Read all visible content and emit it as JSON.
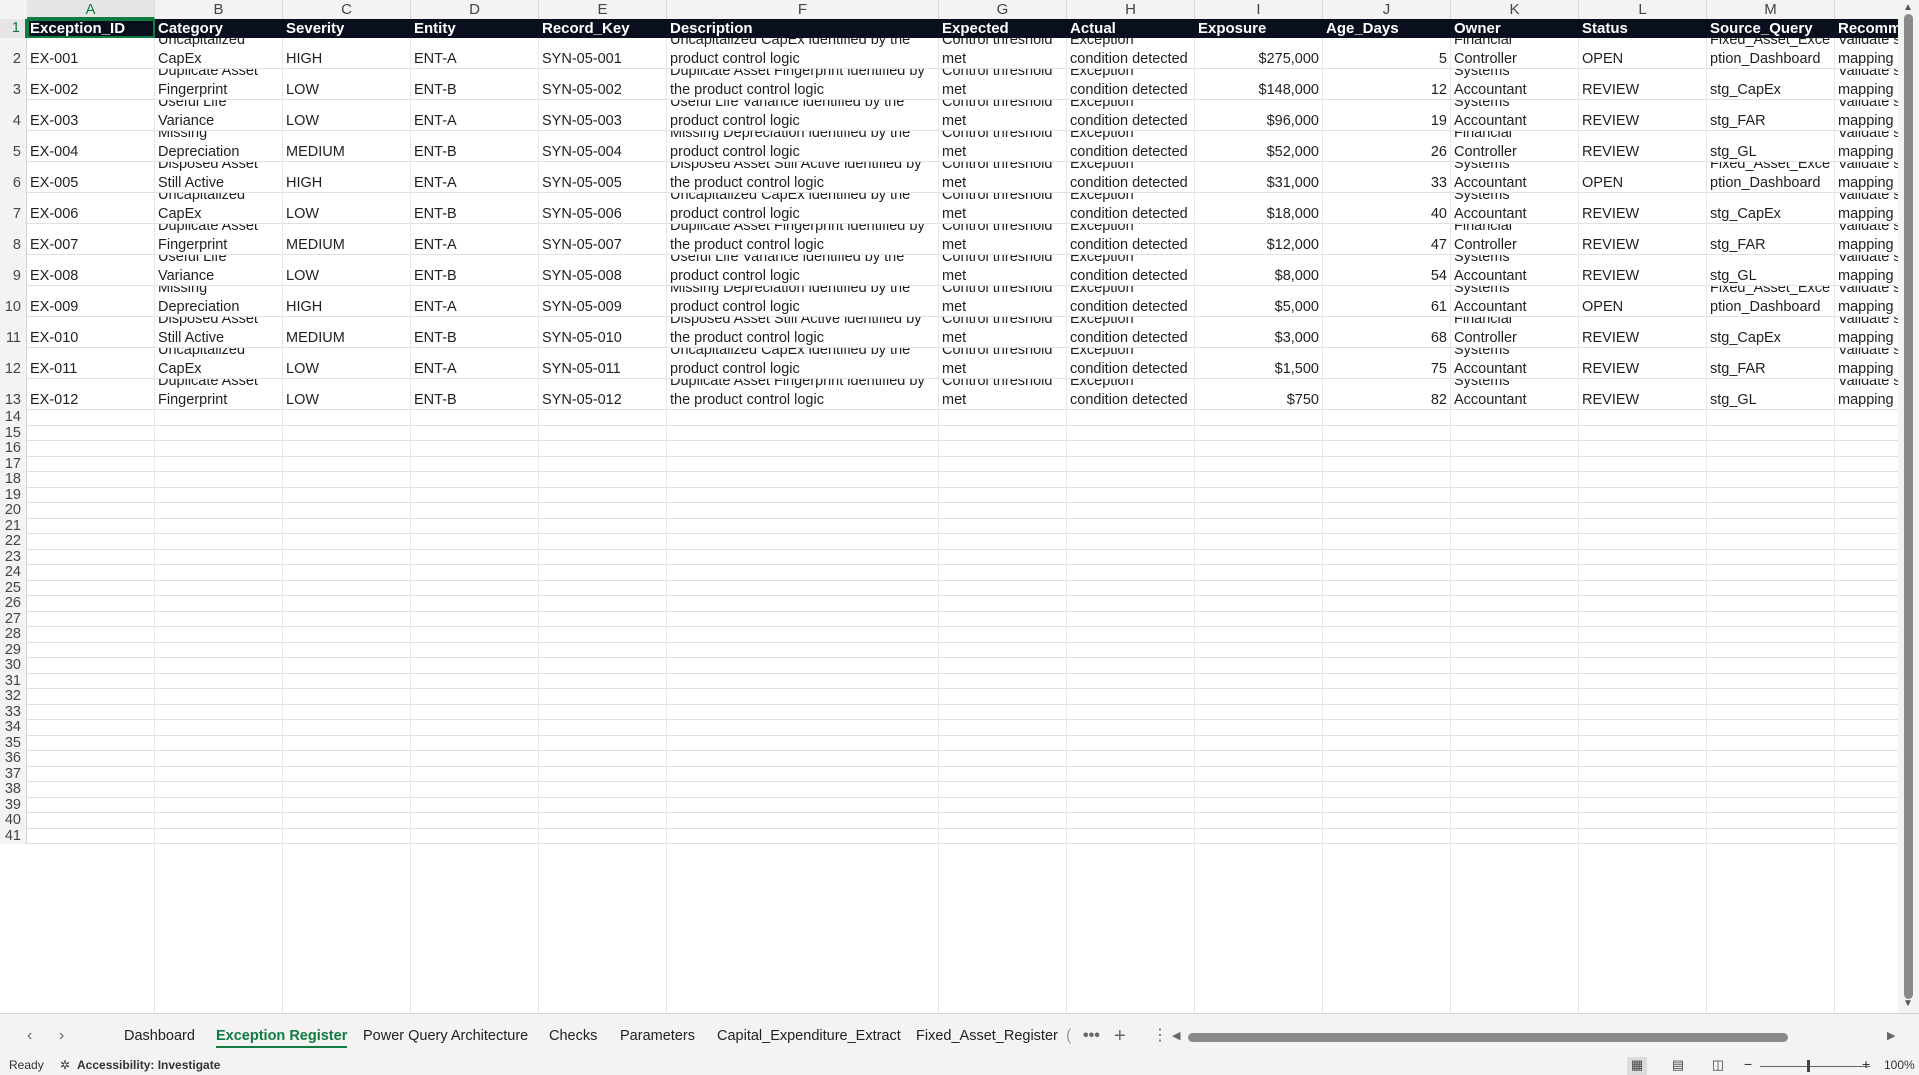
{
  "columns": [
    {
      "letter": "A",
      "header": "Exception_ID"
    },
    {
      "letter": "B",
      "header": "Category"
    },
    {
      "letter": "C",
      "header": "Severity"
    },
    {
      "letter": "D",
      "header": "Entity"
    },
    {
      "letter": "E",
      "header": "Record_Key"
    },
    {
      "letter": "F",
      "header": "Description"
    },
    {
      "letter": "G",
      "header": "Expected"
    },
    {
      "letter": "H",
      "header": "Actual"
    },
    {
      "letter": "I",
      "header": "Exposure"
    },
    {
      "letter": "J",
      "header": "Age_Days"
    },
    {
      "letter": "K",
      "header": "Owner"
    },
    {
      "letter": "L",
      "header": "Status"
    },
    {
      "letter": "M",
      "header": "Source_Query"
    },
    {
      "letter": "",
      "header": "Recomm"
    }
  ],
  "rows": [
    {
      "n": "2",
      "id": "EX-001",
      "cat": [
        "Uncapitalized",
        "CapEx"
      ],
      "sev": "HIGH",
      "ent": "ENT-A",
      "key": "SYN-05-001",
      "desc": [
        "Uncapitalized CapEx identified by the",
        "product control logic"
      ],
      "exp": [
        "Control threshold",
        "met"
      ],
      "act": [
        "Exception",
        "condition detected"
      ],
      "expo": "$275,000",
      "age": "5",
      "own": [
        "Financial",
        "Controller"
      ],
      "status": "OPEN",
      "src": [
        "Fixed_Asset_Exce",
        "ption_Dashboard"
      ],
      "rec": [
        "Validate s",
        "mapping"
      ]
    },
    {
      "n": "3",
      "id": "EX-002",
      "cat": [
        "Duplicate Asset",
        "Fingerprint"
      ],
      "sev": "LOW",
      "ent": "ENT-B",
      "key": "SYN-05-002",
      "desc": [
        "Duplicate Asset Fingerprint identified by",
        "the product control logic"
      ],
      "exp": [
        "Control threshold",
        "met"
      ],
      "act": [
        "Exception",
        "condition detected"
      ],
      "expo": "$148,000",
      "age": "12",
      "own": [
        "Systems",
        "Accountant"
      ],
      "status": "REVIEW",
      "src": [
        "",
        "stg_CapEx"
      ],
      "rec": [
        "Validate s",
        "mapping"
      ]
    },
    {
      "n": "4",
      "id": "EX-003",
      "cat": [
        "Useful Life",
        "Variance"
      ],
      "sev": "LOW",
      "ent": "ENT-A",
      "key": "SYN-05-003",
      "desc": [
        "Useful Life Variance identified by the",
        "product control logic"
      ],
      "exp": [
        "Control threshold",
        "met"
      ],
      "act": [
        "Exception",
        "condition detected"
      ],
      "expo": "$96,000",
      "age": "19",
      "own": [
        "Systems",
        "Accountant"
      ],
      "status": "REVIEW",
      "src": [
        "",
        "stg_FAR"
      ],
      "rec": [
        "Validate s",
        "mapping"
      ]
    },
    {
      "n": "5",
      "id": "EX-004",
      "cat": [
        "Missing",
        "Depreciation"
      ],
      "sev": "MEDIUM",
      "ent": "ENT-B",
      "key": "SYN-05-004",
      "desc": [
        "Missing Depreciation identified by the",
        "product control logic"
      ],
      "exp": [
        "Control threshold",
        "met"
      ],
      "act": [
        "Exception",
        "condition detected"
      ],
      "expo": "$52,000",
      "age": "26",
      "own": [
        "Financial",
        "Controller"
      ],
      "status": "REVIEW",
      "src": [
        "",
        "stg_GL"
      ],
      "rec": [
        "Validate s",
        "mapping"
      ]
    },
    {
      "n": "6",
      "id": "EX-005",
      "cat": [
        "Disposed Asset",
        "Still Active"
      ],
      "sev": "HIGH",
      "ent": "ENT-A",
      "key": "SYN-05-005",
      "desc": [
        "Disposed Asset Still Active identified by",
        "the product control logic"
      ],
      "exp": [
        "Control threshold",
        "met"
      ],
      "act": [
        "Exception",
        "condition detected"
      ],
      "expo": "$31,000",
      "age": "33",
      "own": [
        "Systems",
        "Accountant"
      ],
      "status": "OPEN",
      "src": [
        "Fixed_Asset_Exce",
        "ption_Dashboard"
      ],
      "rec": [
        "Validate s",
        "mapping"
      ]
    },
    {
      "n": "7",
      "id": "EX-006",
      "cat": [
        "Uncapitalized",
        "CapEx"
      ],
      "sev": "LOW",
      "ent": "ENT-B",
      "key": "SYN-05-006",
      "desc": [
        "Uncapitalized CapEx identified by the",
        "product control logic"
      ],
      "exp": [
        "Control threshold",
        "met"
      ],
      "act": [
        "Exception",
        "condition detected"
      ],
      "expo": "$18,000",
      "age": "40",
      "own": [
        "Systems",
        "Accountant"
      ],
      "status": "REVIEW",
      "src": [
        "",
        "stg_CapEx"
      ],
      "rec": [
        "Validate s",
        "mapping"
      ]
    },
    {
      "n": "8",
      "id": "EX-007",
      "cat": [
        "Duplicate Asset",
        "Fingerprint"
      ],
      "sev": "MEDIUM",
      "ent": "ENT-A",
      "key": "SYN-05-007",
      "desc": [
        "Duplicate Asset Fingerprint identified by",
        "the product control logic"
      ],
      "exp": [
        "Control threshold",
        "met"
      ],
      "act": [
        "Exception",
        "condition detected"
      ],
      "expo": "$12,000",
      "age": "47",
      "own": [
        "Financial",
        "Controller"
      ],
      "status": "REVIEW",
      "src": [
        "",
        "stg_FAR"
      ],
      "rec": [
        "Validate s",
        "mapping"
      ]
    },
    {
      "n": "9",
      "id": "EX-008",
      "cat": [
        "Useful Life",
        "Variance"
      ],
      "sev": "LOW",
      "ent": "ENT-B",
      "key": "SYN-05-008",
      "desc": [
        "Useful Life Variance identified by the",
        "product control logic"
      ],
      "exp": [
        "Control threshold",
        "met"
      ],
      "act": [
        "Exception",
        "condition detected"
      ],
      "expo": "$8,000",
      "age": "54",
      "own": [
        "Systems",
        "Accountant"
      ],
      "status": "REVIEW",
      "src": [
        "",
        "stg_GL"
      ],
      "rec": [
        "Validate s",
        "mapping"
      ]
    },
    {
      "n": "10",
      "id": "EX-009",
      "cat": [
        "Missing",
        "Depreciation"
      ],
      "sev": "HIGH",
      "ent": "ENT-A",
      "key": "SYN-05-009",
      "desc": [
        "Missing Depreciation identified by the",
        "product control logic"
      ],
      "exp": [
        "Control threshold",
        "met"
      ],
      "act": [
        "Exception",
        "condition detected"
      ],
      "expo": "$5,000",
      "age": "61",
      "own": [
        "Systems",
        "Accountant"
      ],
      "status": "OPEN",
      "src": [
        "Fixed_Asset_Exce",
        "ption_Dashboard"
      ],
      "rec": [
        "Validate s",
        "mapping"
      ]
    },
    {
      "n": "11",
      "id": "EX-010",
      "cat": [
        "Disposed Asset",
        "Still Active"
      ],
      "sev": "MEDIUM",
      "ent": "ENT-B",
      "key": "SYN-05-010",
      "desc": [
        "Disposed Asset Still Active identified by",
        "the product control logic"
      ],
      "exp": [
        "Control threshold",
        "met"
      ],
      "act": [
        "Exception",
        "condition detected"
      ],
      "expo": "$3,000",
      "age": "68",
      "own": [
        "Financial",
        "Controller"
      ],
      "status": "REVIEW",
      "src": [
        "",
        "stg_CapEx"
      ],
      "rec": [
        "Validate s",
        "mapping"
      ]
    },
    {
      "n": "12",
      "id": "EX-011",
      "cat": [
        "Uncapitalized",
        "CapEx"
      ],
      "sev": "LOW",
      "ent": "ENT-A",
      "key": "SYN-05-011",
      "desc": [
        "Uncapitalized CapEx identified by the",
        "product control logic"
      ],
      "exp": [
        "Control threshold",
        "met"
      ],
      "act": [
        "Exception",
        "condition detected"
      ],
      "expo": "$1,500",
      "age": "75",
      "own": [
        "Systems",
        "Accountant"
      ],
      "status": "REVIEW",
      "src": [
        "",
        "stg_FAR"
      ],
      "rec": [
        "Validate s",
        "mapping"
      ]
    },
    {
      "n": "13",
      "id": "EX-012",
      "cat": [
        "Duplicate Asset",
        "Fingerprint"
      ],
      "sev": "LOW",
      "ent": "ENT-B",
      "key": "SYN-05-012",
      "desc": [
        "Duplicate Asset Fingerprint identified by",
        "the product control logic"
      ],
      "exp": [
        "Control threshold",
        "met"
      ],
      "act": [
        "Exception",
        "condition detected"
      ],
      "expo": "$750",
      "age": "82",
      "own": [
        "Systems",
        "Accountant"
      ],
      "status": "REVIEW",
      "src": [
        "",
        "stg_GL"
      ],
      "rec": [
        "Validate s",
        "mapping"
      ]
    }
  ],
  "empty_rows": [
    "14",
    "15",
    "16",
    "17",
    "18",
    "19",
    "20",
    "21",
    "22",
    "23",
    "24",
    "25",
    "26",
    "27",
    "28",
    "29",
    "30",
    "31",
    "32",
    "33",
    "34",
    "35",
    "36",
    "37",
    "38",
    "39",
    "40",
    "41"
  ],
  "header_row_number": "1",
  "tabs": [
    "Dashboard",
    "Exception Register",
    "Power Query Architecture",
    "Checks",
    "Parameters",
    "Capital_Expenditure_Extract",
    "Fixed_Asset_Register"
  ],
  "active_tab": "Exception Register",
  "status": {
    "ready": "Ready",
    "accessibility": "Accessibility: Investigate",
    "zoom": "100%"
  },
  "colors": {
    "header_bg": "#0a0f1e",
    "accent": "#107c41"
  },
  "icons": {
    "prev": "chevron-left-icon",
    "next": "chevron-right-icon",
    "more": "ellipsis-icon",
    "add": "plus-icon",
    "options": "vertical-dots-icon",
    "accessibility": "accessibility-icon"
  }
}
